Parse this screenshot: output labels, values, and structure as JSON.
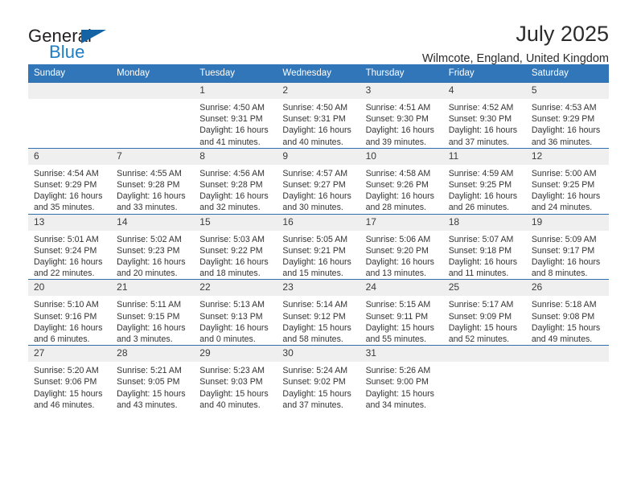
{
  "brand": {
    "name_part1": "General",
    "name_part2": "Blue",
    "triangle_icon": "triangle-logo-icon",
    "accent_color": "#1464a5",
    "blue_text_color": "#1f7dc4"
  },
  "header": {
    "title": "July 2025",
    "location": "Wilmcote, England, United Kingdom"
  },
  "theme": {
    "header_bg": "#3176b9",
    "daynum_bg": "#efefef",
    "row_border": "#2f6fad"
  },
  "columns": [
    "Sunday",
    "Monday",
    "Tuesday",
    "Wednesday",
    "Thursday",
    "Friday",
    "Saturday"
  ],
  "weeks": [
    [
      {
        "day": "",
        "blank": true,
        "sunrise": "",
        "sunset": "",
        "daylight1": "",
        "daylight2": ""
      },
      {
        "day": "",
        "blank": true,
        "sunrise": "",
        "sunset": "",
        "daylight1": "",
        "daylight2": ""
      },
      {
        "day": "1",
        "sunrise": "Sunrise: 4:50 AM",
        "sunset": "Sunset: 9:31 PM",
        "daylight1": "Daylight: 16 hours",
        "daylight2": "and 41 minutes."
      },
      {
        "day": "2",
        "sunrise": "Sunrise: 4:50 AM",
        "sunset": "Sunset: 9:31 PM",
        "daylight1": "Daylight: 16 hours",
        "daylight2": "and 40 minutes."
      },
      {
        "day": "3",
        "sunrise": "Sunrise: 4:51 AM",
        "sunset": "Sunset: 9:30 PM",
        "daylight1": "Daylight: 16 hours",
        "daylight2": "and 39 minutes."
      },
      {
        "day": "4",
        "sunrise": "Sunrise: 4:52 AM",
        "sunset": "Sunset: 9:30 PM",
        "daylight1": "Daylight: 16 hours",
        "daylight2": "and 37 minutes."
      },
      {
        "day": "5",
        "sunrise": "Sunrise: 4:53 AM",
        "sunset": "Sunset: 9:29 PM",
        "daylight1": "Daylight: 16 hours",
        "daylight2": "and 36 minutes."
      }
    ],
    [
      {
        "day": "6",
        "sunrise": "Sunrise: 4:54 AM",
        "sunset": "Sunset: 9:29 PM",
        "daylight1": "Daylight: 16 hours",
        "daylight2": "and 35 minutes."
      },
      {
        "day": "7",
        "sunrise": "Sunrise: 4:55 AM",
        "sunset": "Sunset: 9:28 PM",
        "daylight1": "Daylight: 16 hours",
        "daylight2": "and 33 minutes."
      },
      {
        "day": "8",
        "sunrise": "Sunrise: 4:56 AM",
        "sunset": "Sunset: 9:28 PM",
        "daylight1": "Daylight: 16 hours",
        "daylight2": "and 32 minutes."
      },
      {
        "day": "9",
        "sunrise": "Sunrise: 4:57 AM",
        "sunset": "Sunset: 9:27 PM",
        "daylight1": "Daylight: 16 hours",
        "daylight2": "and 30 minutes."
      },
      {
        "day": "10",
        "sunrise": "Sunrise: 4:58 AM",
        "sunset": "Sunset: 9:26 PM",
        "daylight1": "Daylight: 16 hours",
        "daylight2": "and 28 minutes."
      },
      {
        "day": "11",
        "sunrise": "Sunrise: 4:59 AM",
        "sunset": "Sunset: 9:25 PM",
        "daylight1": "Daylight: 16 hours",
        "daylight2": "and 26 minutes."
      },
      {
        "day": "12",
        "sunrise": "Sunrise: 5:00 AM",
        "sunset": "Sunset: 9:25 PM",
        "daylight1": "Daylight: 16 hours",
        "daylight2": "and 24 minutes."
      }
    ],
    [
      {
        "day": "13",
        "sunrise": "Sunrise: 5:01 AM",
        "sunset": "Sunset: 9:24 PM",
        "daylight1": "Daylight: 16 hours",
        "daylight2": "and 22 minutes."
      },
      {
        "day": "14",
        "sunrise": "Sunrise: 5:02 AM",
        "sunset": "Sunset: 9:23 PM",
        "daylight1": "Daylight: 16 hours",
        "daylight2": "and 20 minutes."
      },
      {
        "day": "15",
        "sunrise": "Sunrise: 5:03 AM",
        "sunset": "Sunset: 9:22 PM",
        "daylight1": "Daylight: 16 hours",
        "daylight2": "and 18 minutes."
      },
      {
        "day": "16",
        "sunrise": "Sunrise: 5:05 AM",
        "sunset": "Sunset: 9:21 PM",
        "daylight1": "Daylight: 16 hours",
        "daylight2": "and 15 minutes."
      },
      {
        "day": "17",
        "sunrise": "Sunrise: 5:06 AM",
        "sunset": "Sunset: 9:20 PM",
        "daylight1": "Daylight: 16 hours",
        "daylight2": "and 13 minutes."
      },
      {
        "day": "18",
        "sunrise": "Sunrise: 5:07 AM",
        "sunset": "Sunset: 9:18 PM",
        "daylight1": "Daylight: 16 hours",
        "daylight2": "and 11 minutes."
      },
      {
        "day": "19",
        "sunrise": "Sunrise: 5:09 AM",
        "sunset": "Sunset: 9:17 PM",
        "daylight1": "Daylight: 16 hours",
        "daylight2": "and 8 minutes."
      }
    ],
    [
      {
        "day": "20",
        "sunrise": "Sunrise: 5:10 AM",
        "sunset": "Sunset: 9:16 PM",
        "daylight1": "Daylight: 16 hours",
        "daylight2": "and 6 minutes."
      },
      {
        "day": "21",
        "sunrise": "Sunrise: 5:11 AM",
        "sunset": "Sunset: 9:15 PM",
        "daylight1": "Daylight: 16 hours",
        "daylight2": "and 3 minutes."
      },
      {
        "day": "22",
        "sunrise": "Sunrise: 5:13 AM",
        "sunset": "Sunset: 9:13 PM",
        "daylight1": "Daylight: 16 hours",
        "daylight2": "and 0 minutes."
      },
      {
        "day": "23",
        "sunrise": "Sunrise: 5:14 AM",
        "sunset": "Sunset: 9:12 PM",
        "daylight1": "Daylight: 15 hours",
        "daylight2": "and 58 minutes."
      },
      {
        "day": "24",
        "sunrise": "Sunrise: 5:15 AM",
        "sunset": "Sunset: 9:11 PM",
        "daylight1": "Daylight: 15 hours",
        "daylight2": "and 55 minutes."
      },
      {
        "day": "25",
        "sunrise": "Sunrise: 5:17 AM",
        "sunset": "Sunset: 9:09 PM",
        "daylight1": "Daylight: 15 hours",
        "daylight2": "and 52 minutes."
      },
      {
        "day": "26",
        "sunrise": "Sunrise: 5:18 AM",
        "sunset": "Sunset: 9:08 PM",
        "daylight1": "Daylight: 15 hours",
        "daylight2": "and 49 minutes."
      }
    ],
    [
      {
        "day": "27",
        "sunrise": "Sunrise: 5:20 AM",
        "sunset": "Sunset: 9:06 PM",
        "daylight1": "Daylight: 15 hours",
        "daylight2": "and 46 minutes."
      },
      {
        "day": "28",
        "sunrise": "Sunrise: 5:21 AM",
        "sunset": "Sunset: 9:05 PM",
        "daylight1": "Daylight: 15 hours",
        "daylight2": "and 43 minutes."
      },
      {
        "day": "29",
        "sunrise": "Sunrise: 5:23 AM",
        "sunset": "Sunset: 9:03 PM",
        "daylight1": "Daylight: 15 hours",
        "daylight2": "and 40 minutes."
      },
      {
        "day": "30",
        "sunrise": "Sunrise: 5:24 AM",
        "sunset": "Sunset: 9:02 PM",
        "daylight1": "Daylight: 15 hours",
        "daylight2": "and 37 minutes."
      },
      {
        "day": "31",
        "sunrise": "Sunrise: 5:26 AM",
        "sunset": "Sunset: 9:00 PM",
        "daylight1": "Daylight: 15 hours",
        "daylight2": "and 34 minutes."
      },
      {
        "day": "",
        "blank": true,
        "sunrise": "",
        "sunset": "",
        "daylight1": "",
        "daylight2": ""
      },
      {
        "day": "",
        "blank": true,
        "sunrise": "",
        "sunset": "",
        "daylight1": "",
        "daylight2": ""
      }
    ]
  ]
}
